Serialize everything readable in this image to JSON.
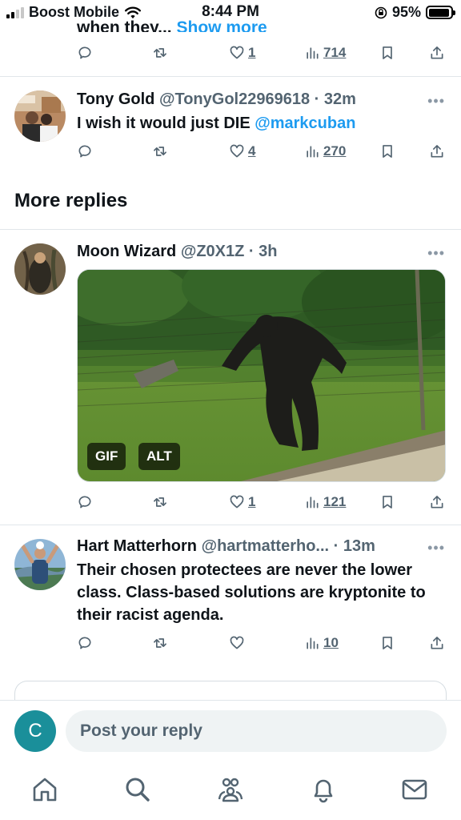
{
  "status_bar": {
    "carrier": "Boost Mobile",
    "time": "8:44 PM",
    "battery_percent": "95%",
    "battery_level": 0.95
  },
  "previous_tweet": {
    "cutoff_text": "when they...",
    "show_more": "Show more",
    "likes": "1",
    "views": "714"
  },
  "tweets": [
    {
      "name": "Tony Gold",
      "handle": "@TonyGol22969618",
      "time": "· 32m",
      "text": "I wish it would just DIE ",
      "mention": "@markcuban",
      "likes": "4",
      "views": "270"
    },
    {
      "name": "Moon Wizard",
      "handle": "@Z0X1Z",
      "time": "· 3h",
      "media_badges": [
        "GIF",
        "ALT"
      ],
      "likes": "1",
      "views": "121"
    },
    {
      "name": "Hart Matterhorn",
      "handle": "@hartmatterho...",
      "time": "· 13m",
      "text": "Their chosen protectees are never the lower class. Class-based solutions are kryptonite to their racist agenda.",
      "likes": "",
      "views": "10"
    }
  ],
  "section_title": "More replies",
  "compose": {
    "avatar_letter": "C",
    "placeholder": "Post your reply"
  },
  "more_dots": "•••",
  "colors": {
    "accent": "#1d9bf0",
    "muted": "#536471",
    "avatar_bg": "#1a8f9a"
  }
}
